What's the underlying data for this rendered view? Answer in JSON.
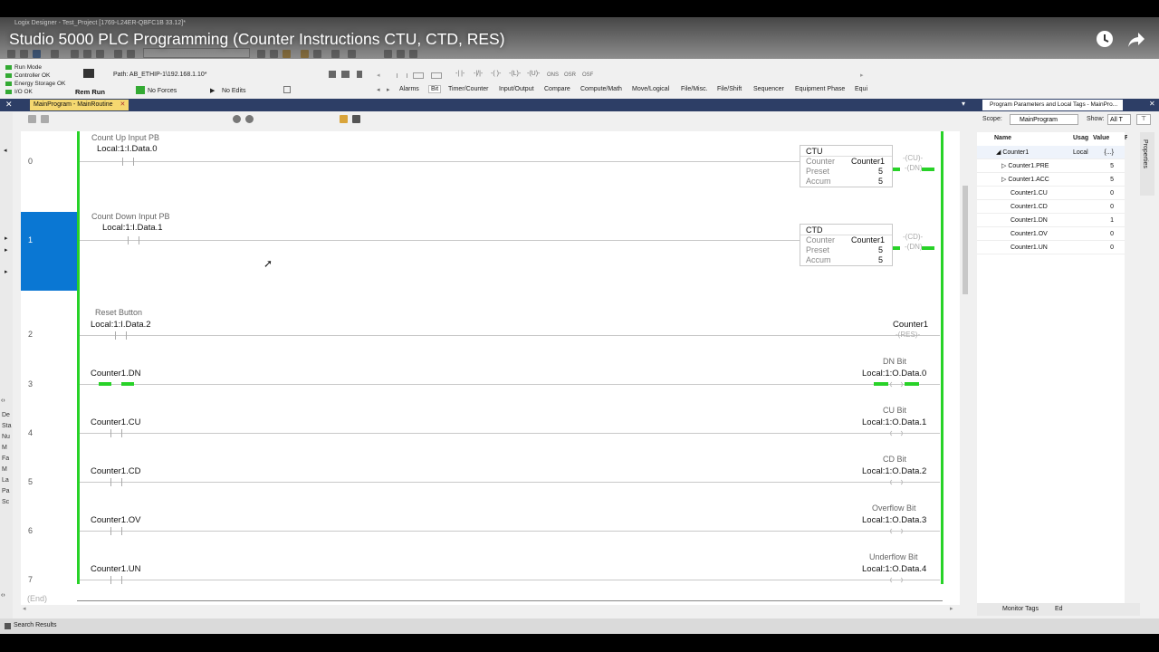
{
  "video": {
    "title": "Studio 5000 PLC Programming (Counter Instructions CTU, CTD, RES)"
  },
  "window_title": "Logix Designer - Test_Project [1769-L24ER-QBFC1B 33.12]*",
  "status": {
    "mode": "Run Mode",
    "controller": "Controller OK",
    "energy": "Energy Storage OK",
    "io": "I/O OK",
    "key": "Rem Run",
    "forces": "No Forces",
    "edits": "No Edits",
    "path": "Path: AB_ETHIP-1\\192.168.1.10*"
  },
  "instr_toolbar": [
    "Alarms",
    "Bit",
    "Timer/Counter",
    "Input/Output",
    "Compare",
    "Compute/Math",
    "Move/Logical",
    "File/Misc.",
    "File/Shift",
    "Sequencer",
    "Equipment Phase",
    "Equi"
  ],
  "instr_symbols": [
    "ONS",
    "OSR",
    "OSF"
  ],
  "routine_tab": "MainProgram - MainRoutine",
  "rungs": [
    {
      "num": "0",
      "desc": "Count Up Input PB",
      "tag": "Local:1:I.Data.0",
      "box": {
        "name": "CTU",
        "counter_label": "Counter",
        "counter": "Counter1",
        "preset_label": "Preset",
        "preset": "5",
        "accum_label": "Accum",
        "accum": "5",
        "o1": "CU",
        "o2": "DN"
      }
    },
    {
      "num": "1",
      "desc": "Count Down Input PB",
      "tag": "Local:1:I.Data.1",
      "box": {
        "name": "CTD",
        "counter_label": "Counter",
        "counter": "Counter1",
        "preset_label": "Preset",
        "preset": "5",
        "accum_label": "Accum",
        "accum": "5",
        "o1": "CD",
        "o2": "DN"
      }
    },
    {
      "num": "2",
      "desc": "Reset Button",
      "tag": "Local:1:I.Data.2",
      "out_tag": "Counter1",
      "out_instr": "RES"
    },
    {
      "num": "3",
      "tag": "Counter1.DN",
      "out_desc": "DN Bit",
      "out_tag": "Local:1:O.Data.0"
    },
    {
      "num": "4",
      "tag": "Counter1.CU",
      "out_desc": "CU Bit",
      "out_tag": "Local:1:O.Data.1"
    },
    {
      "num": "5",
      "tag": "Counter1.CD",
      "out_desc": "CD Bit",
      "out_tag": "Local:1:O.Data.2"
    },
    {
      "num": "6",
      "tag": "Counter1.OV",
      "out_desc": "Overflow Bit",
      "out_tag": "Local:1:O.Data.3"
    },
    {
      "num": "7",
      "tag": "Counter1.UN",
      "out_desc": "Underflow Bit",
      "out_tag": "Local:1:O.Data.4"
    }
  ],
  "end_label": "(End)",
  "right_panel": {
    "title": "Program Parameters and Local Tags - MainPro...",
    "scope_label": "Scope:",
    "scope_value": "MainProgram",
    "show_label": "Show:",
    "show_value": "All T",
    "columns": {
      "name": "Name",
      "usage": "Usag",
      "value": "Value",
      "force": "Fo"
    },
    "tags": [
      {
        "name": "Counter1",
        "usage": "Local",
        "value": "{...}"
      },
      {
        "name": "Counter1.PRE",
        "usage": "",
        "value": "5"
      },
      {
        "name": "Counter1.ACC",
        "usage": "",
        "value": "5"
      },
      {
        "name": "Counter1.CU",
        "usage": "",
        "value": "0"
      },
      {
        "name": "Counter1.CD",
        "usage": "",
        "value": "0"
      },
      {
        "name": "Counter1.DN",
        "usage": "",
        "value": "1"
      },
      {
        "name": "Counter1.OV",
        "usage": "",
        "value": "0"
      },
      {
        "name": "Counter1.UN",
        "usage": "",
        "value": "0"
      }
    ],
    "bottom_tabs": [
      "Monitor Tags",
      "Ed"
    ],
    "properties": "Properties"
  },
  "left_strip": [
    "De",
    "Sta",
    "Nu",
    "M",
    "Fa",
    "M",
    "La",
    "Pa",
    "Sc"
  ],
  "bottom_bar": "Search Results",
  "colors": {
    "accent_navy": "#2d3e66",
    "energized_green": "#28d228",
    "selected_rung": "#0a77d3",
    "tab_yellow": "#f5d870"
  }
}
